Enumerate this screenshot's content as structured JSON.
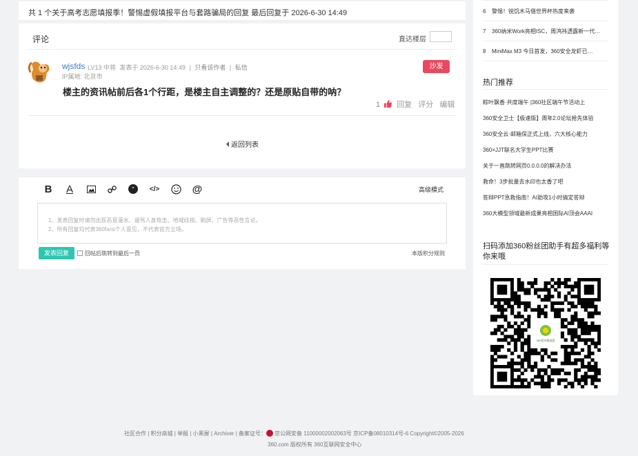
{
  "topbar": {
    "text": "共 1 个关于高考志愿填报季！警惕虚假填报平台与套路骗局的回复 最后回复于 2026-6-30 14:49"
  },
  "comments": {
    "title": "评论",
    "jump_label": "直达楼层",
    "user": {
      "name": "wjsfds",
      "level": "LV13 中将",
      "posted": "发表于 2026-6-30 14:49",
      "only_author": "只看该作者",
      "message": "私信",
      "ip": "IP属地: 北京市"
    },
    "sofa": "沙发",
    "post_text": "楼主的资讯帖前后各1个行距，是楼主自主调整的？还是原贴自带的呐？",
    "likes": "1",
    "reply": "回复",
    "rate": "评分",
    "edit": "编辑",
    "back": "返回列表"
  },
  "editor": {
    "advanced": "高级模式",
    "hints": [
      "1、发表回复时请勿出现恶意灌水、谩骂人身攻击、地域歧视、刷屏、广告等恶性言论。",
      "2、所有回复均代表360fans个人意见，不代表官方立场。"
    ],
    "submit": "发表回复",
    "jump_last": "回帖后跳转到最后一页",
    "rules": "本版积分规则"
  },
  "sidebar": {
    "news": [
      {
        "n": "6",
        "text": "警惕！锐饥木马借世界杯热度来袭"
      },
      {
        "n": "7",
        "text": "360纳米Work亮相ISC，周鸿祎透露新一代…"
      },
      {
        "n": "8",
        "text": "MiniMax M3 今日首发，360安全龙虾已…"
      }
    ],
    "hot_title": "热门推荐",
    "hot": [
      "粽叶飘香·共度端午 |360社区端午节活动上",
      "360安全卫士【极速版】周年2.0论坛抢先体验",
      "360安全云·邮箱保正式上线，六大核心能力",
      "360×JJT联名大学生PPT比赛",
      "关于一直跳转网页0.0.0.0的解决办法",
      "救命！3步批量去水印也太香了吧",
      "答辩PPT急救指南！AI助攻1小时搞定答辩",
      "360大模型领域最新成果亮相国际AI顶会AAAI"
    ],
    "qr_title": "扫码添加360粉丝团助手有超多福利等你来哦",
    "qr_center": "360官方粉丝团"
  },
  "footer": {
    "line1_links": [
      "社区合作",
      "积分商城",
      "举报",
      "小黑屋",
      "Archiver"
    ],
    "record": "备案证号：",
    "police": "京公网安备 11000002002063号 京ICP备08010314号-6",
    "copyright": "Copyright©2005-2026",
    "line2": "360.com 版权所有 360互联网安全中心"
  },
  "colors": {
    "accent_teal": "#2ec6b0",
    "sofa_red": "#e8495e",
    "link_blue": "#3a7ac6"
  }
}
